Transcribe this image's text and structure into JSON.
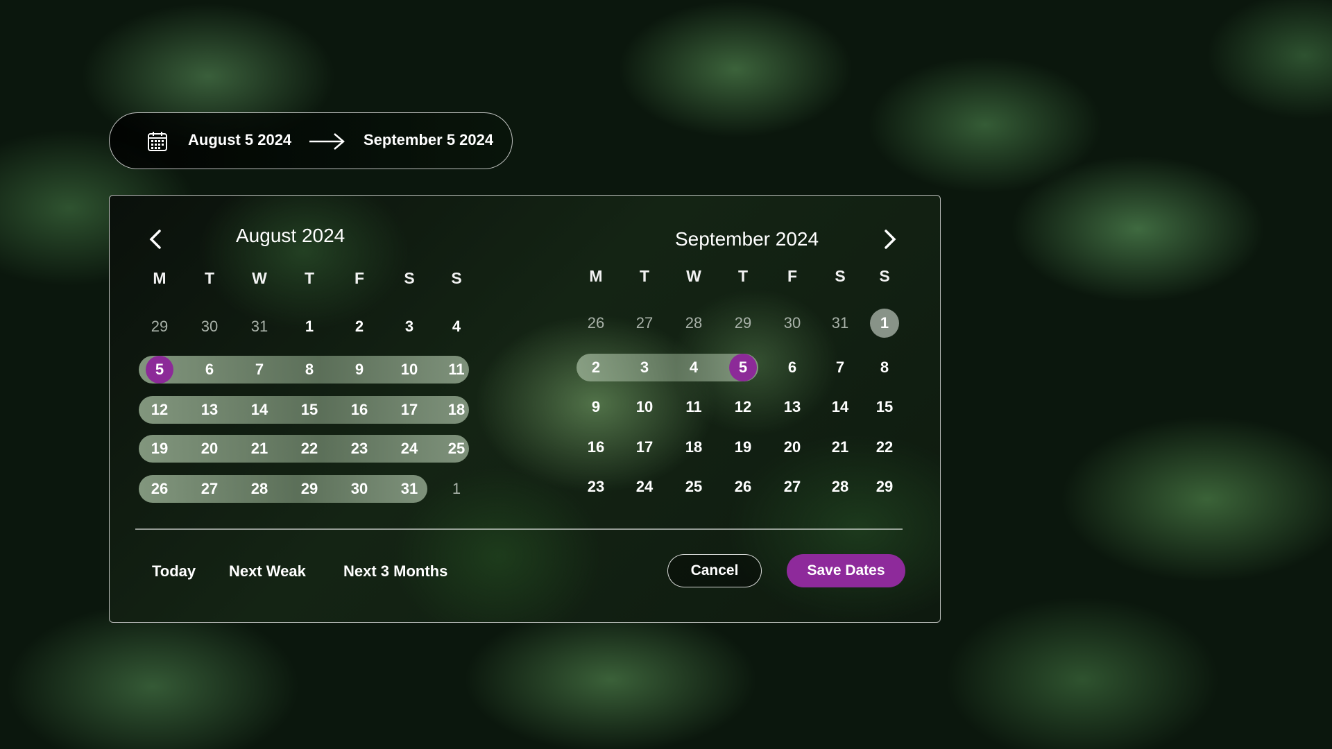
{
  "range_input": {
    "start": "August 5 2024",
    "end": "September 5 2024",
    "calendar_icon": "calendar-icon",
    "arrow_icon": "arrow-right-icon"
  },
  "left_month": {
    "month": "August",
    "year": "2024",
    "weekdays": [
      "M",
      "T",
      "W",
      "T",
      "F",
      "S",
      "S"
    ],
    "days": [
      "29",
      "30",
      "31",
      "1",
      "2",
      "3",
      "4",
      "5",
      "6",
      "7",
      "8",
      "9",
      "10",
      "11",
      "12",
      "13",
      "14",
      "15",
      "16",
      "17",
      "18",
      "19",
      "20",
      "21",
      "22",
      "23",
      "24",
      "25",
      "26",
      "27",
      "28",
      "29",
      "30",
      "31",
      "1"
    ],
    "prev_icon": "chevron-left-icon"
  },
  "right_month": {
    "month": "September",
    "year": "2024",
    "weekdays": [
      "M",
      "T",
      "W",
      "T",
      "F",
      "S",
      "S"
    ],
    "days": [
      "26",
      "27",
      "28",
      "29",
      "30",
      "31",
      "1",
      "2",
      "3",
      "4",
      "5",
      "6",
      "7",
      "8",
      "9",
      "10",
      "11",
      "12",
      "13",
      "14",
      "15",
      "16",
      "17",
      "18",
      "19",
      "20",
      "21",
      "22",
      "23",
      "24",
      "25",
      "26",
      "27",
      "28",
      "29"
    ],
    "next_icon": "chevron-right-icon"
  },
  "quick_actions": [
    "Today",
    "Next Weak",
    "Next 3 Months"
  ],
  "buttons": {
    "cancel": "Cancel",
    "save": "Save Dates"
  },
  "colors": {
    "accent": "#8e2a9b",
    "range_fill": "#96ac91",
    "background": "#0b170d"
  }
}
